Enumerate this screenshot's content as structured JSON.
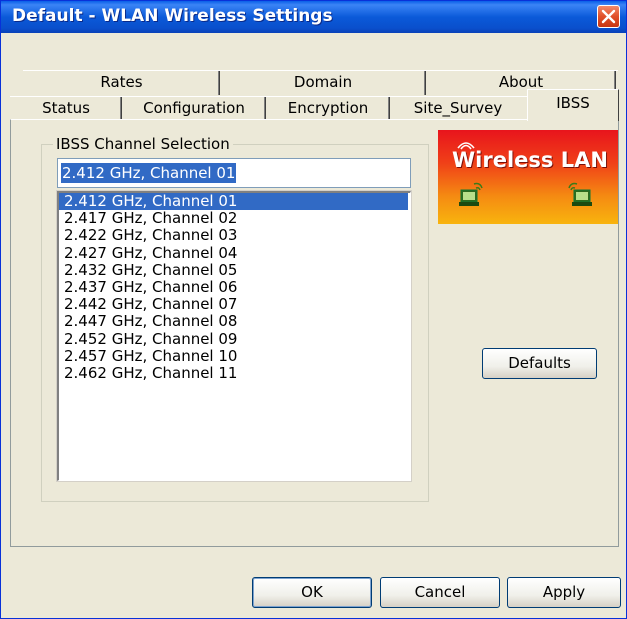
{
  "window": {
    "title": "Default - WLAN Wireless Settings"
  },
  "tabs": {
    "top_row": [
      "Rates",
      "Domain",
      "About"
    ],
    "bottom_row": [
      "Status",
      "Configuration",
      "Encryption",
      "Site_Survey"
    ],
    "active": "IBSS"
  },
  "ibss": {
    "group_label": "IBSS Channel Selection",
    "selected_value": "2.412 GHz, Channel 01",
    "channels": [
      "2.412 GHz, Channel 01",
      "2.417 GHz, Channel 02",
      "2.422 GHz, Channel 03",
      "2.427 GHz, Channel 04",
      "2.432 GHz, Channel 05",
      "2.437 GHz, Channel 06",
      "2.442 GHz, Channel 07",
      "2.447 GHz, Channel 08",
      "2.452 GHz, Channel 09",
      "2.457 GHz, Channel 10",
      "2.462 GHz, Channel 11"
    ],
    "selected_index": 0
  },
  "logo": {
    "text": "Wireless LAN"
  },
  "buttons": {
    "defaults": "Defaults",
    "ok": "OK",
    "cancel": "Cancel",
    "apply": "Apply"
  },
  "colors": {
    "title_bar": "#0A5FE8",
    "selection": "#316AC5",
    "close_button": "#E0502A",
    "dialog_bg": "#ECE9D8"
  },
  "icons": [
    "close-icon",
    "wireless-computer-icon"
  ]
}
